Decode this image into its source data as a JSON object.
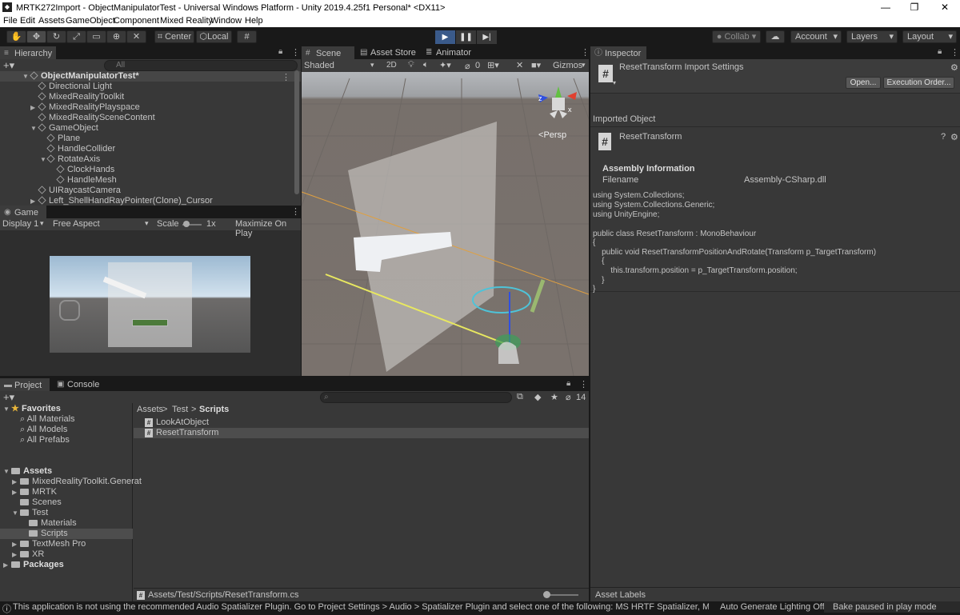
{
  "window": {
    "title": "MRTK272Import - ObjectManipulatorTest - Universal Windows Platform - Unity 2019.4.25f1 Personal* <DX11>",
    "minimize": "—",
    "restore": "❐",
    "close": "✕"
  },
  "menu": [
    "File",
    "Edit",
    "Assets",
    "GameObject",
    "Component",
    "Mixed Reality",
    "Window",
    "Help"
  ],
  "toolbar": {
    "center": "Center",
    "local": "Local",
    "collab": "Collab",
    "account": "Account",
    "layers": "Layers",
    "layout": "Layout"
  },
  "hierarchy": {
    "tab": "Hierarchy",
    "search": "All",
    "scene": "ObjectManipulatorTest*",
    "items": [
      "Directional Light",
      "MixedRealityToolkit",
      "MixedRealityPlayspace",
      "MixedRealitySceneContent",
      "GameObject",
      "Plane",
      "HandleCollider",
      "RotateAxis",
      "ClockHands",
      "HandleMesh",
      "UIRaycastCamera",
      "Left_ShellHandRayPointer(Clone)_Cursor"
    ]
  },
  "game": {
    "tab": "Game",
    "display": "Display 1",
    "aspect": "Free Aspect",
    "scale_label": "Scale",
    "scale_value": "1x",
    "maximize": "Maximize On Play"
  },
  "scene": {
    "tabs": [
      "Scene",
      "Asset Store",
      "Animator"
    ],
    "shading": "Shaded",
    "mode2d": "2D",
    "hidden_count": "0",
    "gizmos": "Gizmos",
    "persp": "Persp"
  },
  "project": {
    "tabs": [
      "Project",
      "Console"
    ],
    "favorites": "Favorites",
    "fav_items": [
      "All Materials",
      "All Models",
      "All Prefabs"
    ],
    "assets": "Assets",
    "tree": [
      "MixedRealityToolkit.Generat",
      "MRTK",
      "Scenes",
      "Test",
      "Materials",
      "Scripts",
      "TextMesh Pro",
      "XR"
    ],
    "packages": "Packages",
    "breadcrumb": [
      "Assets",
      "Test",
      "Scripts"
    ],
    "files": [
      "LookAtObject",
      "ResetTransform"
    ],
    "hidden": "14",
    "path": "Assets/Test/Scripts/ResetTransform.cs"
  },
  "inspector": {
    "tab": "Inspector",
    "header": "ResetTransform Import Settings",
    "open": "Open...",
    "exec": "Execution Order...",
    "imported": "Imported Object",
    "obj": "ResetTransform",
    "asm_info": "Assembly Information",
    "filename_label": "Filename",
    "filename": "Assembly-CSharp.dll",
    "code": [
      "using System.Collections;",
      "using System.Collections.Generic;",
      "using UnityEngine;",
      "",
      "public class ResetTransform : MonoBehaviour",
      "{",
      "    public void ResetTransformPositionAndRotate(Transform p_TargetTransform)",
      "    {",
      "        this.transform.position = p_TargetTransform.position;",
      "    }",
      "}"
    ],
    "asset_labels": "Asset Labels"
  },
  "status": {
    "message": "This application is not using the recommended Audio Spatializer Plugin. Go to Project Settings > Audio > Spatializer Plugin and select one of the following: MS HRTF Spatializer, Microsoft Sp",
    "lighting": "Auto Generate Lighting Off",
    "bake": "Bake paused in play mode"
  }
}
